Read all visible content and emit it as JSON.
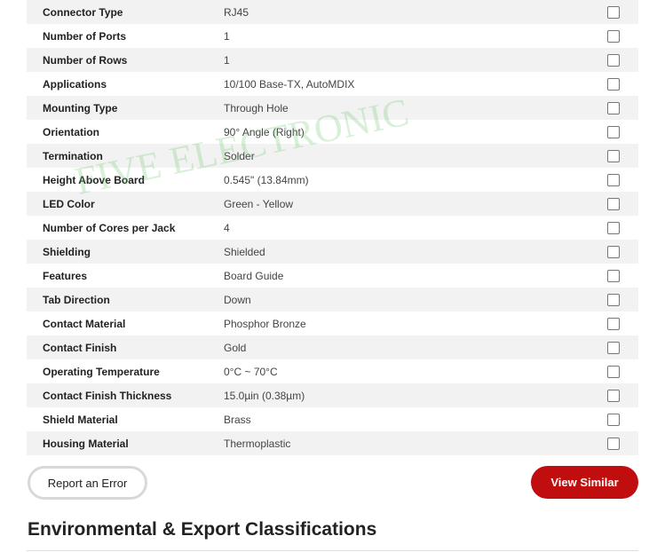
{
  "specs": [
    {
      "label": "Connector Type",
      "value": "RJ45"
    },
    {
      "label": "Number of Ports",
      "value": "1"
    },
    {
      "label": "Number of Rows",
      "value": "1"
    },
    {
      "label": "Applications",
      "value": "10/100 Base-TX, AutoMDIX"
    },
    {
      "label": "Mounting Type",
      "value": "Through Hole"
    },
    {
      "label": "Orientation",
      "value": "90° Angle (Right)"
    },
    {
      "label": "Termination",
      "value": "Solder"
    },
    {
      "label": "Height Above Board",
      "value": "0.545\" (13.84mm)"
    },
    {
      "label": "LED Color",
      "value": "Green - Yellow"
    },
    {
      "label": "Number of Cores per Jack",
      "value": "4"
    },
    {
      "label": "Shielding",
      "value": "Shielded"
    },
    {
      "label": "Features",
      "value": "Board Guide"
    },
    {
      "label": "Tab Direction",
      "value": "Down"
    },
    {
      "label": "Contact Material",
      "value": "Phosphor Bronze"
    },
    {
      "label": "Contact Finish",
      "value": "Gold"
    },
    {
      "label": "Operating Temperature",
      "value": "0°C ~ 70°C"
    },
    {
      "label": "Contact Finish Thickness",
      "value": "15.0µin (0.38µm)"
    },
    {
      "label": "Shield Material",
      "value": "Brass"
    },
    {
      "label": "Housing Material",
      "value": "Thermoplastic"
    }
  ],
  "buttons": {
    "report": "Report an Error",
    "similar": "View Similar"
  },
  "section": {
    "title": "Environmental & Export Classifications"
  },
  "watermark": "FIVE ELECTRONIC",
  "colors": {
    "accent": "#c00d0d",
    "row_shade": "#f2f2f2"
  }
}
